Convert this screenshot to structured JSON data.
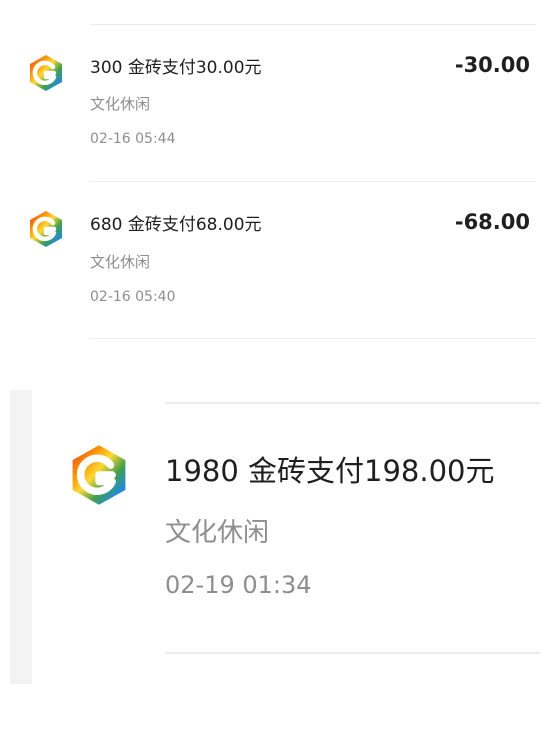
{
  "transactions": [
    {
      "title": "300 金砖支付30.00元",
      "category": "文化休闲",
      "time": "02-16 05:44",
      "amount": "-30.00"
    },
    {
      "title": "680 金砖支付68.00元",
      "category": "文化休闲",
      "time": "02-16 05:40",
      "amount": "-68.00"
    }
  ],
  "zoomed_transaction": {
    "title": "1980 金砖支付198.00元",
    "category": "文化休闲",
    "time": "02-19 01:34"
  },
  "logo": {
    "icon": "rainbow-hexagon-g-logo-icon",
    "colors": [
      "#e53935",
      "#fb8c00",
      "#fdd835",
      "#43a047",
      "#1e88e5",
      "#8e24aa"
    ]
  }
}
